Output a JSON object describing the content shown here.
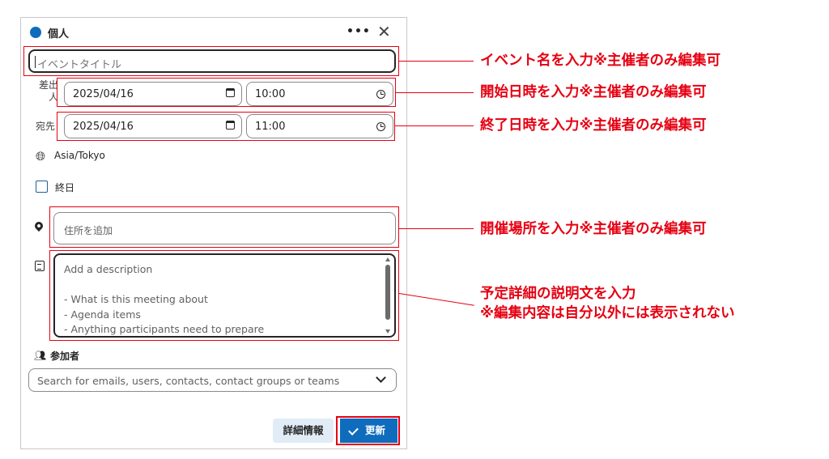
{
  "dialog": {
    "calendar_name": "個人",
    "more_label": "•••",
    "close_label": "✕",
    "title_placeholder": "イベントタイトル",
    "row_label_start": "差出\n人",
    "row_label_end": "宛先",
    "start": {
      "date": "2025/04/16",
      "time": "10:00"
    },
    "end": {
      "date": "2025/04/16",
      "time": "11:00"
    },
    "timezone": "Asia/Tokyo",
    "timezone_icon": "globe-icon",
    "all_day_label": "終日",
    "all_day_checked": false,
    "location_placeholder": "住所を追加",
    "description_placeholder": "Add a description\n\n- What is this meeting about\n- Agenda items\n- Anything participants need to prepare",
    "attendees_label": "参加者",
    "attendees_placeholder": "Search for emails, users, contacts, contact groups or teams",
    "details_button": "詳細情報",
    "update_button": "更新",
    "accent_color": "#0f6cbd"
  },
  "annotations": {
    "color": "#e60012",
    "title": "イベント名を入力※主催者のみ編集可",
    "start": "開始日時を入力※主催者のみ編集可",
    "end": "終了日時を入力※主催者のみ編集可",
    "location": "開催場所を入力※主催者のみ編集可",
    "description_line1": "予定詳細の説明文を入力",
    "description_line2": "※編集内容は自分以外には表示されない"
  }
}
